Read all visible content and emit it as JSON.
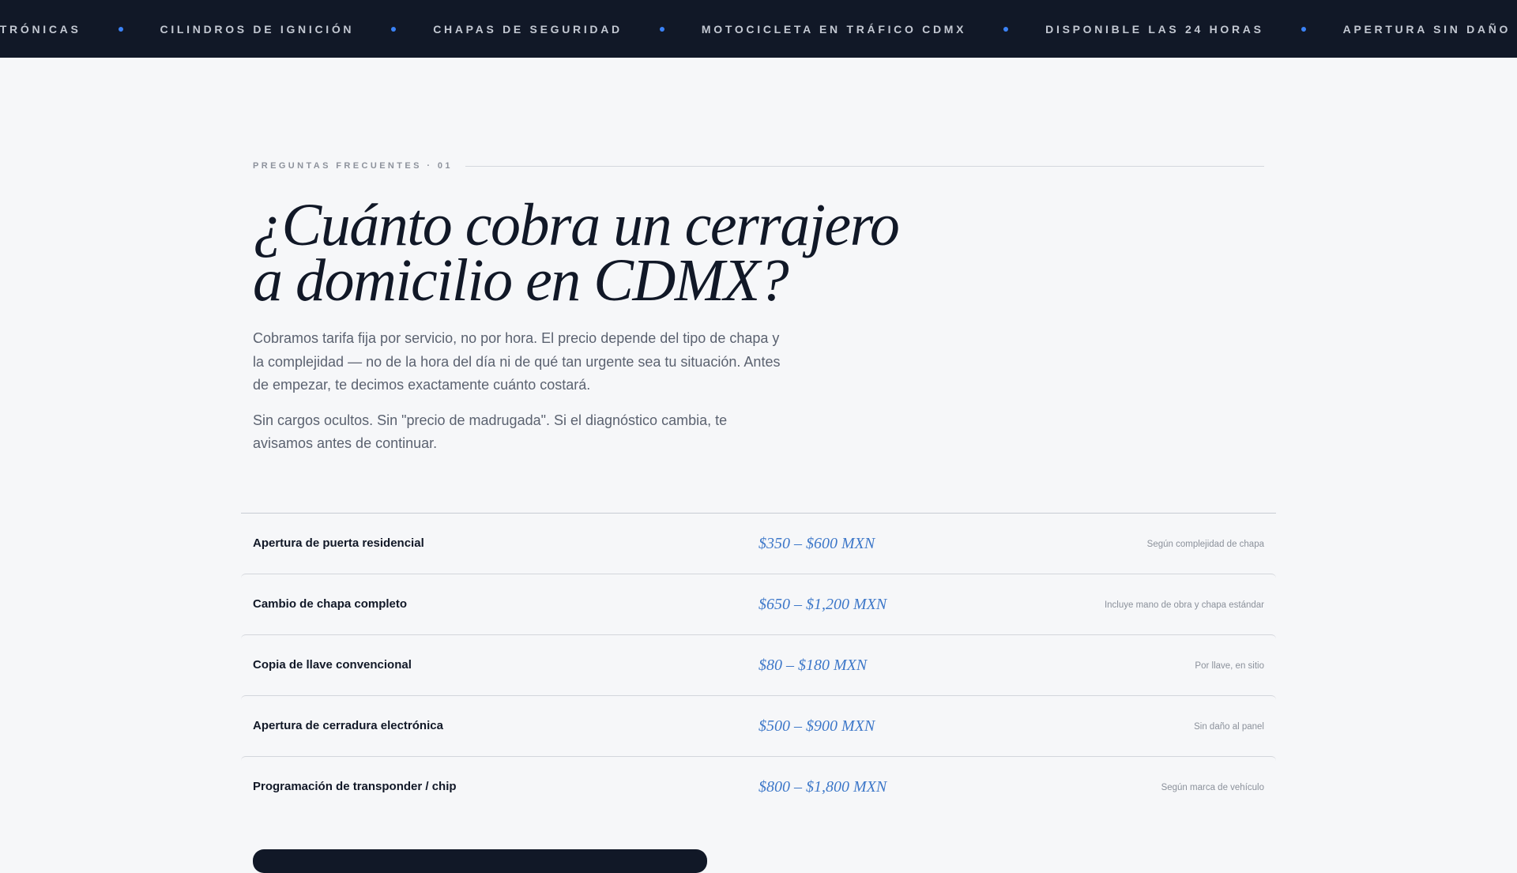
{
  "ticker": {
    "items": [
      "ctrónicas",
      "Cilindros de ignición",
      "Chapas de seguridad",
      "Motocicleta en tráfico CDMX",
      "Disponible las 24 horas",
      "Apertura sin daño"
    ]
  },
  "faq": {
    "eyebrow": "PREGUNTAS FRECUENTES · 01",
    "title_line1": "¿Cuánto cobra un cerrajero",
    "title_line2": "a domicilio en CDMX?",
    "paragraph1": "Cobramos tarifa fija por servicio, no por hora. El precio depende del tipo de chapa y la complejidad — no de la hora del día ni de qué tan urgente sea tu situación. Antes de empezar, te decimos exactamente cuánto costará.",
    "paragraph2": "Sin cargos ocultos. Sin \"precio de madrugada\". Si el diagnóstico cambia, te avisamos antes de continuar."
  },
  "prices": [
    {
      "service": "Apertura de puerta residencial",
      "range": "$350 – $600 MXN",
      "note": "Según complejidad de chapa"
    },
    {
      "service": "Cambio de chapa completo",
      "range": "$650 – $1,200 MXN",
      "note": "Incluye mano de obra y chapa estándar"
    },
    {
      "service": "Copia de llave convencional",
      "range": "$80 – $180 MXN",
      "note": "Por llave, en sitio"
    },
    {
      "service": "Apertura de cerradura electrónica",
      "range": "$500 – $900 MXN",
      "note": "Sin daño al panel"
    },
    {
      "service": "Programación de transponder / chip",
      "range": "$800 – $1,800 MXN",
      "note": "Según marca de vehículo"
    }
  ],
  "colors": {
    "ticker_bg": "#111827",
    "accent": "#3b82f6",
    "price": "#3e78c9",
    "page_bg": "#f6f7f9"
  }
}
